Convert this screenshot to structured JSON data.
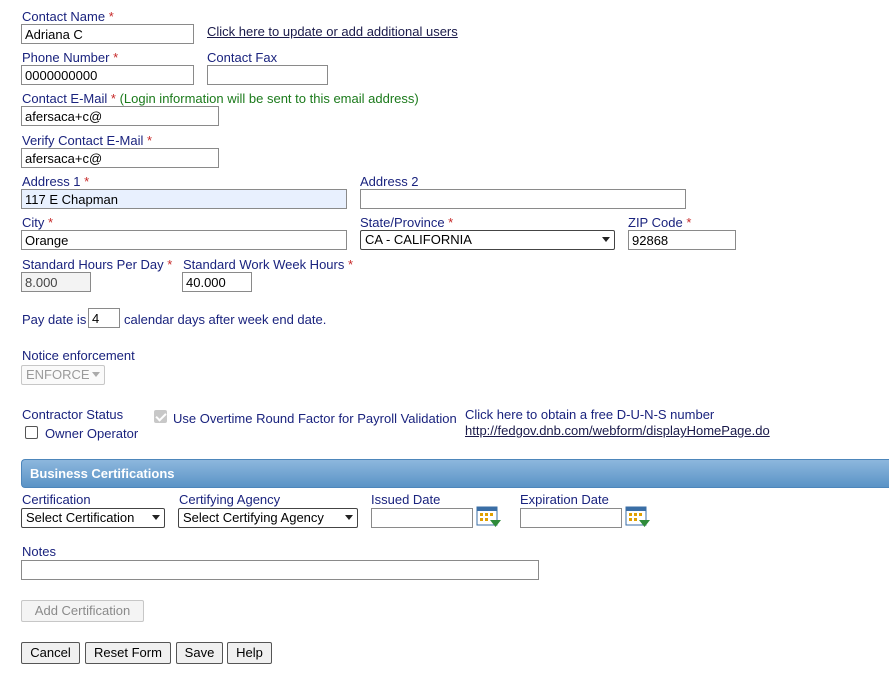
{
  "required_mark": "*",
  "contact": {
    "name_label": "Contact Name",
    "name_value": "Adriana C",
    "update_users_link": "Click here to update or add additional users",
    "phone_label": "Phone Number",
    "phone_value": "0000000000",
    "fax_label": "Contact Fax",
    "fax_value": "",
    "email_label": "Contact E-Mail",
    "email_note": "(Login information will be sent to this email address)",
    "email_value": "afersaca+c@",
    "verify_email_label": "Verify Contact E-Mail",
    "verify_email_value": "afersaca+c@"
  },
  "address": {
    "address1_label": "Address 1",
    "address1_value": "117 E Chapman",
    "address2_label": "Address 2",
    "address2_value": "",
    "city_label": "City",
    "city_value": "Orange",
    "state_label": "State/Province",
    "state_value": "CA - CALIFORNIA",
    "zip_label": "ZIP Code",
    "zip_value": "92868"
  },
  "hours": {
    "per_day_label": "Standard Hours Per Day",
    "per_day_value": "8.000",
    "work_week_label": "Standard Work Week Hours",
    "work_week_value": "40.000"
  },
  "pay_date": {
    "prefix": "Pay date is",
    "value": "4",
    "suffix": "calendar days after week end date."
  },
  "notice": {
    "label": "Notice enforcement",
    "value": "ENFORCE"
  },
  "contractor": {
    "status_label": "Contractor Status",
    "owner_operator_label": "Owner Operator",
    "owner_operator_checked": false,
    "overtime_label": "Use Overtime Round Factor for Payroll Validation",
    "overtime_checked": true,
    "duns_text": "Click here to obtain a free D-U-N-S number",
    "duns_link": "http://fedgov.dnb.com/webform/displayHomePage.do"
  },
  "certifications": {
    "section_title": "Business Certifications",
    "certification_label": "Certification",
    "certification_value": "Select Certification",
    "agency_label": "Certifying Agency",
    "agency_value": "Select Certifying Agency",
    "issued_label": "Issued Date",
    "issued_value": "",
    "expiration_label": "Expiration Date",
    "expiration_value": "",
    "notes_label": "Notes",
    "notes_value": "",
    "add_button": "Add Certification"
  },
  "footer": {
    "cancel": "Cancel",
    "reset": "Reset Form",
    "save": "Save",
    "help": "Help"
  },
  "colors": {
    "label": "#1a237e",
    "required": "#c62828",
    "note": "#1b7a1b",
    "section_bar": "#6ea2d2"
  }
}
